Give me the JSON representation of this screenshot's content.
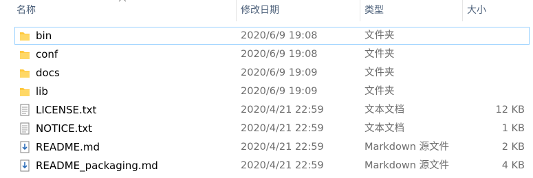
{
  "columns": {
    "name": "名称",
    "modified": "修改日期",
    "type": "类型",
    "size": "大小"
  },
  "files": [
    {
      "name": "bin",
      "modified": "2020/6/9 19:08",
      "type": "文件夹",
      "size": "",
      "icon": "folder-icon"
    },
    {
      "name": "conf",
      "modified": "2020/6/9 19:08",
      "type": "文件夹",
      "size": "",
      "icon": "folder-icon"
    },
    {
      "name": "docs",
      "modified": "2020/6/9 19:09",
      "type": "文件夹",
      "size": "",
      "icon": "folder-icon"
    },
    {
      "name": "lib",
      "modified": "2020/6/9 19:09",
      "type": "文件夹",
      "size": "",
      "icon": "folder-icon"
    },
    {
      "name": "LICENSE.txt",
      "modified": "2020/4/21 22:59",
      "type": "文本文档",
      "size": "12 KB",
      "icon": "text-file-icon"
    },
    {
      "name": "NOTICE.txt",
      "modified": "2020/4/21 22:59",
      "type": "文本文档",
      "size": "1 KB",
      "icon": "text-file-icon"
    },
    {
      "name": "README.md",
      "modified": "2020/4/21 22:59",
      "type": "Markdown 源文件",
      "size": "2 KB",
      "icon": "markdown-file-icon"
    },
    {
      "name": "README_packaging.md",
      "modified": "2020/4/21 22:59",
      "type": "Markdown 源文件",
      "size": "4 KB",
      "icon": "markdown-file-icon"
    }
  ],
  "colors": {
    "header_text": "#4c607a",
    "secondary_text": "#6d6d6d",
    "focus_border": "#99d1ff",
    "folder": "#ffc83d"
  }
}
